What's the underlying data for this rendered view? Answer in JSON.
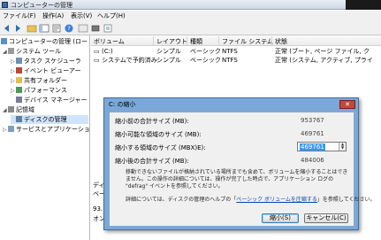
{
  "window": {
    "title": "コンピューターの管理"
  },
  "menu": [
    "ファイル(F)",
    "操作(A)",
    "表示(V)",
    "ヘルプ(H)"
  ],
  "tree": {
    "root": "コンピューターの管理 (ロー",
    "items": [
      "システム ツール",
      "タスク スケジューラ",
      "イベント ビューアー",
      "共有フォルダー",
      "パフォーマンス",
      "デバイス マネージャー",
      "記憶域",
      "ディスクの管理",
      "サービスとアプリケーショ"
    ]
  },
  "list": {
    "columns": [
      "ボリューム",
      "レイアウト",
      "種類",
      "ファイル システム",
      "状態"
    ],
    "rows": [
      {
        "volume": "(C:)",
        "layout": "シンプル",
        "type": "ベーシック",
        "fs": "NTFS",
        "status": "正常 (ブート, ページ ファイル, ク"
      },
      {
        "volume": "システムで予約済み",
        "layout": "シンプル",
        "type": "ベーシック",
        "fs": "NTFS",
        "status": "正常 (システム, アクティブ, プライ"
      }
    ],
    "peek": [
      "ディ",
      "ベー",
      "93.",
      "オン"
    ]
  },
  "dialog": {
    "title": "C: の縮小",
    "close": "✕",
    "fields": [
      {
        "label": "縮小前の合計サイズ (MB):",
        "value": "953767"
      },
      {
        "label": "縮小可能な領域のサイズ (MB):",
        "value": "469761"
      },
      {
        "label": "縮小する領域のサイズ (MBX)E):",
        "value": "469761"
      },
      {
        "label": "縮小後の合計サイズ (MB):",
        "value": "484006"
      }
    ],
    "note": "移動できないファイルが格納されている場所までも含めて、ボリュームを縮小することはできません。この操作の詳細については、操作が完了した時点で、アプリケーション ログの \"defrag\" イベントを参照してください。",
    "more_info_prefix": "詳細については、ディスクの管理のヘルプの「",
    "more_info_link": "ベーシック ボリュームを圧縮する",
    "more_info_suffix": "」を参照してください。",
    "shrink_button": "縮小(S)",
    "cancel_button": "キャンセル(C)"
  },
  "colors": {
    "dialog_frame": "#7aa8d8",
    "selection": "#3399ff",
    "link": "#0645ad"
  }
}
